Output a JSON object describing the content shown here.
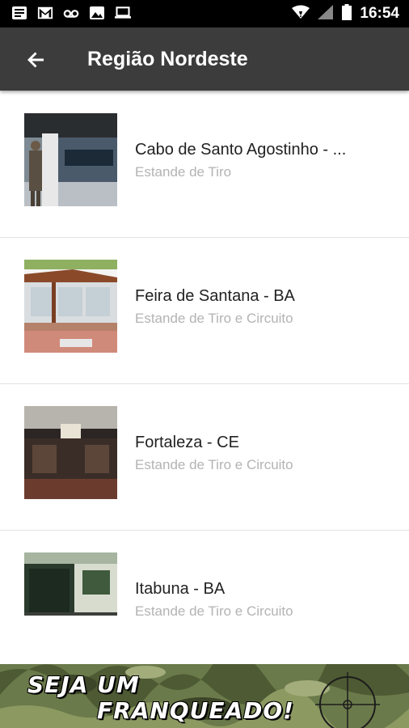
{
  "status_bar": {
    "time": "16:54",
    "icons": [
      "news-icon",
      "gmail-icon",
      "voicemail-icon",
      "image-icon",
      "laptop-icon",
      "wifi-icon",
      "signal-icon",
      "battery-icon"
    ]
  },
  "app_bar": {
    "title": "Região Nordeste",
    "back_icon": "arrow-back-icon"
  },
  "locations": [
    {
      "title": "Cabo de Santo Agostinho - ...",
      "subtitle": "Estande de Tiro"
    },
    {
      "title": "Feira de Santana - BA",
      "subtitle": "Estande de Tiro e Circuito"
    },
    {
      "title": "Fortaleza - CE",
      "subtitle": "Estande de Tiro e Circuito"
    },
    {
      "title": "Itabuna - BA",
      "subtitle": "Estande de Tiro e Circuito"
    }
  ],
  "banner": {
    "line1": "SEJA UM",
    "line2": "FRANQUEADO!"
  },
  "colors": {
    "app_bar": "#3c3c3c",
    "status_bar": "#000000",
    "subtitle": "#b3b3b3"
  }
}
